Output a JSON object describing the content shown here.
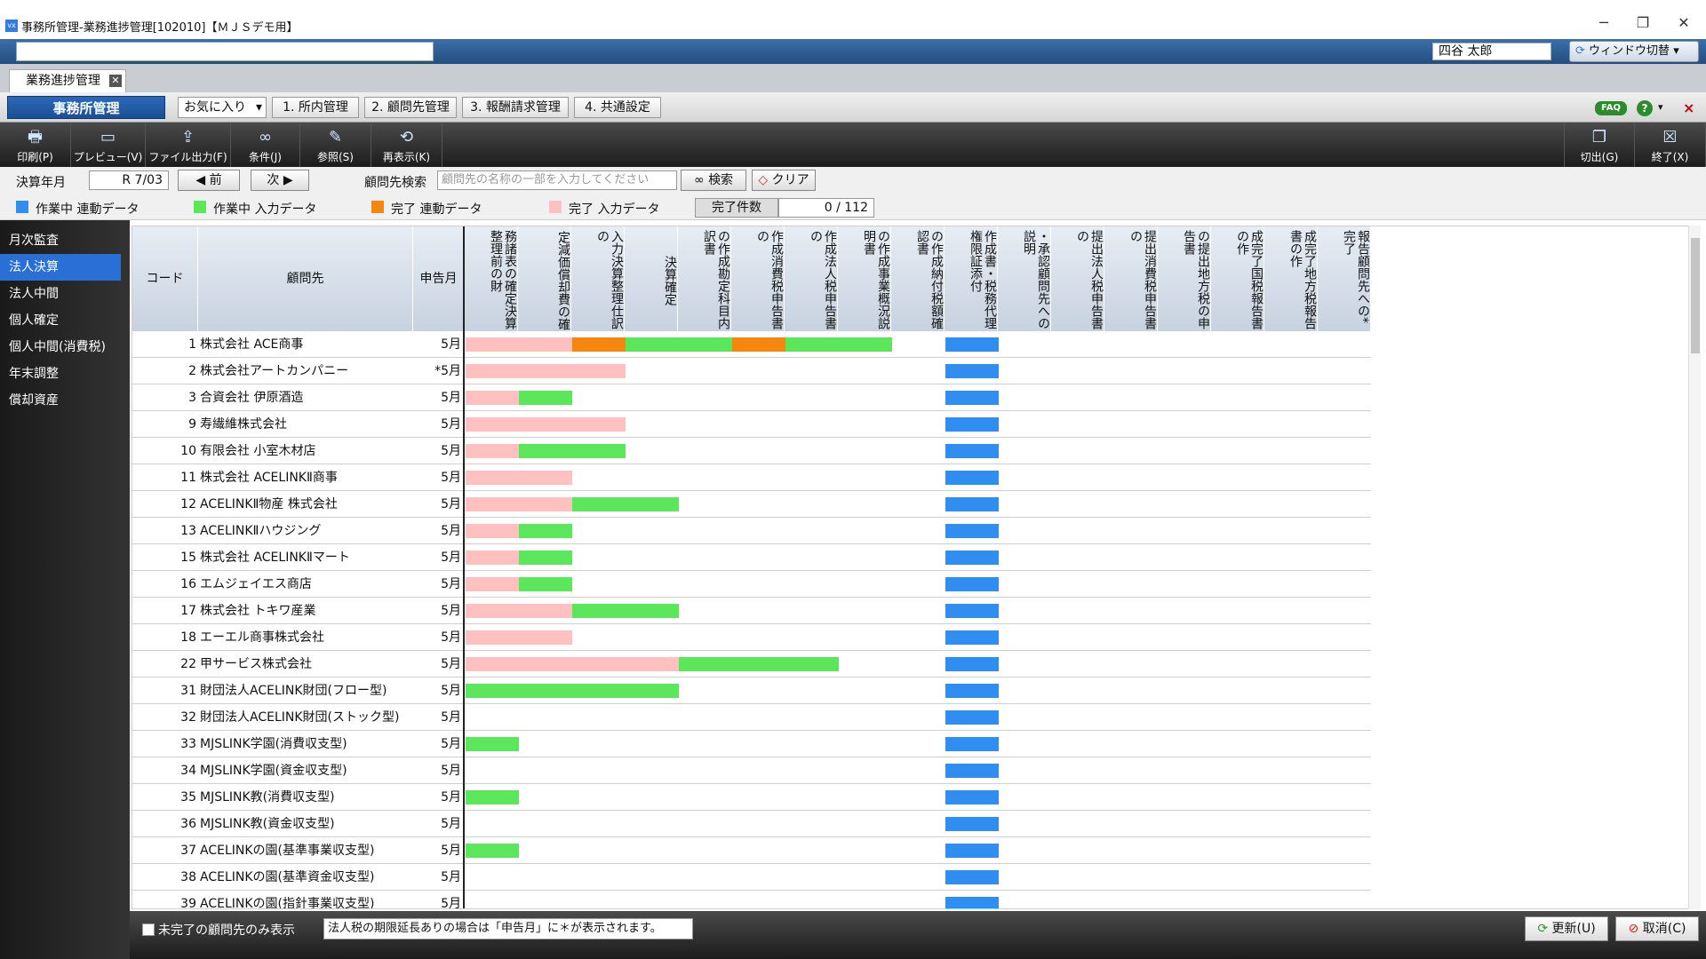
{
  "window": {
    "title": "事務所管理-業務進捗管理[102010]【ＭＪＳデモ用】",
    "app_icon": "vx",
    "min": "─",
    "restore": "❐",
    "close": "✕"
  },
  "header": {
    "user": "四谷 太郎",
    "window_switch": "ウィンドウ切替"
  },
  "doc_tab": {
    "label": "業務進捗管理",
    "close": "✕"
  },
  "menubar": {
    "main": "事務所管理",
    "favorites": "お気に入り",
    "items": [
      "1. 所内管理",
      "2. 顧問先管理",
      "3. 報酬請求管理",
      "4. 共通設定"
    ],
    "faq": "FAQ",
    "help": "?",
    "close": "×"
  },
  "toolbar": {
    "left": [
      "印刷(P)",
      "プレビュー(V)",
      "ファイル出力(F)",
      "条件(J)",
      "参照(S)",
      "再表示(K)"
    ],
    "right": [
      "切出(G)",
      "終了(X)"
    ]
  },
  "filter": {
    "period_label": "決算年月",
    "period_value": "R 7/03",
    "prev": "◀ 前",
    "next": "次 ▶",
    "search_label": "顧問先検索",
    "search_placeholder": "顧問先の名称の一部を入力してください",
    "search_btn": "検索",
    "clear_btn": "クリア"
  },
  "legend": {
    "items": [
      {
        "label": "作業中  連動データ",
        "color": "#2f8ef0"
      },
      {
        "label": "作業中  入力データ",
        "color": "#5ce65c"
      },
      {
        "label": "完了  連動データ",
        "color": "#f5870f"
      },
      {
        "label": "完了  入力データ",
        "color": "#ffc0c0"
      }
    ],
    "count_label": "完了件数",
    "count_value": "0 / 112"
  },
  "sidebar": {
    "items": [
      "月次監査",
      "法人決算",
      "法人中間",
      "個人確定",
      "個人中間(消費税)",
      "年末調整",
      "償却資産"
    ],
    "active_index": 1
  },
  "grid": {
    "headers": {
      "code": "コード",
      "client": "顧問先",
      "month": "申告月"
    },
    "task_headers": [
      "務諸表の確定決算整理前の財",
      "定減価償却費の確",
      "入力決算整理仕訳の",
      "決算確定",
      "の作成勘定科目内訳書",
      "作成消費税申告書の",
      "作成法人税申告書の",
      "の作成事業概況説明書",
      "の作成納付税額確認書",
      "作成書・税務代理権限証添付",
      "・承認顧問先への説明",
      "提出法人税申告書の",
      "提出消費税申告書の",
      "の提出地方税の申告書",
      "成完了国税報告書の作",
      "成完了地方税報告書の作",
      "報告顧問先への*完了"
    ],
    "rows": [
      {
        "code": "1",
        "name": "株式会社 ACE商事",
        "month": "5月",
        "segments": [
          [
            "#ffc0c0",
            0,
            2
          ],
          [
            "#f5870f",
            2,
            1
          ],
          [
            "#5ce65c",
            3,
            2
          ],
          [
            "#f5870f",
            5,
            1
          ],
          [
            "#5ce65c",
            6,
            2
          ],
          [
            "#2f8ef0",
            9,
            1
          ]
        ]
      },
      {
        "code": "2",
        "name": "株式会社アートカンパニー",
        "month": "*5月",
        "segments": [
          [
            "#ffc0c0",
            0,
            3
          ],
          [
            "#2f8ef0",
            9,
            1
          ]
        ]
      },
      {
        "code": "3",
        "name": "合資会社 伊原酒造",
        "month": "5月",
        "segments": [
          [
            "#ffc0c0",
            0,
            1
          ],
          [
            "#5ce65c",
            1,
            1
          ],
          [
            "#2f8ef0",
            9,
            1
          ]
        ]
      },
      {
        "code": "9",
        "name": "寿繊維株式会社",
        "month": "5月",
        "segments": [
          [
            "#ffc0c0",
            0,
            3
          ],
          [
            "#2f8ef0",
            9,
            1
          ]
        ]
      },
      {
        "code": "10",
        "name": "有限会社 小室木材店",
        "month": "5月",
        "segments": [
          [
            "#ffc0c0",
            0,
            1
          ],
          [
            "#5ce65c",
            1,
            2
          ],
          [
            "#2f8ef0",
            9,
            1
          ]
        ]
      },
      {
        "code": "11",
        "name": "株式会社 ACELINKⅡ商事",
        "month": "5月",
        "segments": [
          [
            "#ffc0c0",
            0,
            2
          ],
          [
            "#2f8ef0",
            9,
            1
          ]
        ]
      },
      {
        "code": "12",
        "name": "ACELINKⅡ物産 株式会社",
        "month": "5月",
        "segments": [
          [
            "#ffc0c0",
            0,
            2
          ],
          [
            "#5ce65c",
            2,
            2
          ],
          [
            "#2f8ef0",
            9,
            1
          ]
        ]
      },
      {
        "code": "13",
        "name": "ACELINKⅡハウジング",
        "month": "5月",
        "segments": [
          [
            "#ffc0c0",
            0,
            1
          ],
          [
            "#5ce65c",
            1,
            1
          ],
          [
            "#2f8ef0",
            9,
            1
          ]
        ]
      },
      {
        "code": "15",
        "name": "株式会社 ACELINKⅡマート",
        "month": "5月",
        "segments": [
          [
            "#ffc0c0",
            0,
            1
          ],
          [
            "#5ce65c",
            1,
            1
          ],
          [
            "#2f8ef0",
            9,
            1
          ]
        ]
      },
      {
        "code": "16",
        "name": "エムジェイエス商店",
        "month": "5月",
        "segments": [
          [
            "#ffc0c0",
            0,
            1
          ],
          [
            "#5ce65c",
            1,
            1
          ],
          [
            "#2f8ef0",
            9,
            1
          ]
        ]
      },
      {
        "code": "17",
        "name": "株式会社 トキワ産業",
        "month": "5月",
        "segments": [
          [
            "#ffc0c0",
            0,
            2
          ],
          [
            "#5ce65c",
            2,
            2
          ],
          [
            "#2f8ef0",
            9,
            1
          ]
        ]
      },
      {
        "code": "18",
        "name": "エーエル商事株式会社",
        "month": "5月",
        "segments": [
          [
            "#ffc0c0",
            0,
            2
          ],
          [
            "#2f8ef0",
            9,
            1
          ]
        ]
      },
      {
        "code": "22",
        "name": "甲サービス株式会社",
        "month": "5月",
        "segments": [
          [
            "#ffc0c0",
            0,
            4
          ],
          [
            "#5ce65c",
            4,
            3
          ],
          [
            "#2f8ef0",
            9,
            1
          ]
        ]
      },
      {
        "code": "31",
        "name": "財団法人ACELINK財団(フロー型)",
        "month": "5月",
        "segments": [
          [
            "#5ce65c",
            0,
            4
          ],
          [
            "#2f8ef0",
            9,
            1
          ]
        ]
      },
      {
        "code": "32",
        "name": "財団法人ACELINK財団(ストック型)",
        "month": "5月",
        "segments": [
          [
            "#2f8ef0",
            9,
            1
          ]
        ]
      },
      {
        "code": "33",
        "name": "MJSLINK学園(消費収支型)",
        "month": "5月",
        "segments": [
          [
            "#5ce65c",
            0,
            1
          ],
          [
            "#2f8ef0",
            9,
            1
          ]
        ]
      },
      {
        "code": "34",
        "name": "MJSLINK学園(資金収支型)",
        "month": "5月",
        "segments": [
          [
            "#2f8ef0",
            9,
            1
          ]
        ]
      },
      {
        "code": "35",
        "name": "MJSLINK教(消費収支型)",
        "month": "5月",
        "segments": [
          [
            "#5ce65c",
            0,
            1
          ],
          [
            "#2f8ef0",
            9,
            1
          ]
        ]
      },
      {
        "code": "36",
        "name": "MJSLINK教(資金収支型)",
        "month": "5月",
        "segments": [
          [
            "#2f8ef0",
            9,
            1
          ]
        ]
      },
      {
        "code": "37",
        "name": "ACELINKの園(基準事業収支型)",
        "month": "5月",
        "segments": [
          [
            "#5ce65c",
            0,
            1
          ],
          [
            "#2f8ef0",
            9,
            1
          ]
        ]
      },
      {
        "code": "38",
        "name": "ACELINKの園(基準資金収支型)",
        "month": "5月",
        "segments": [
          [
            "#2f8ef0",
            9,
            1
          ]
        ]
      },
      {
        "code": "39",
        "name": "ACELINKの園(指針事業収支型)",
        "month": "5月",
        "segments": [
          [
            "#2f8ef0",
            9,
            1
          ]
        ]
      }
    ]
  },
  "footer": {
    "unfinished_only": "未完了の顧問先のみ表示",
    "notice": "法人税の期限延長ありの場合は「申告月」に＊が表示されます。",
    "update": "更新(U)",
    "cancel": "取消(C)"
  }
}
